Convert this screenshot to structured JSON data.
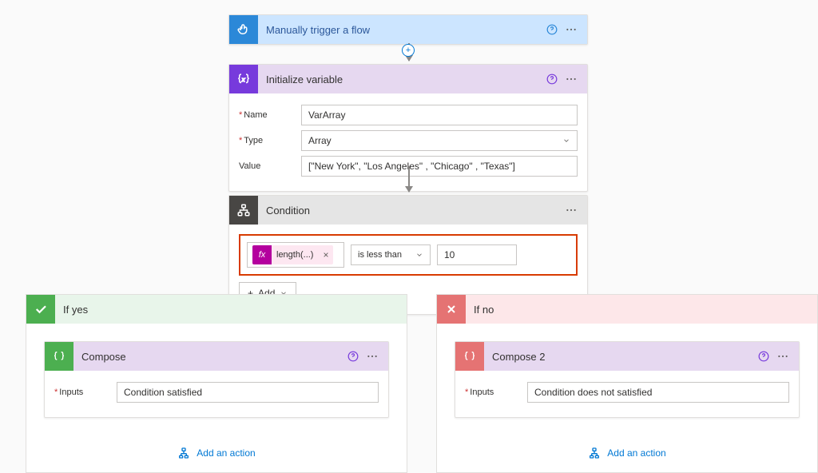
{
  "trigger": {
    "title": "Manually trigger a flow"
  },
  "initvar": {
    "title": "Initialize variable",
    "name_label": "Name",
    "type_label": "Type",
    "value_label": "Value",
    "name_value": "VarArray",
    "type_value": "Array",
    "value_value": "[\"New York\", \"Los Angeles\" , \"Chicago\" , \"Texas\"]"
  },
  "condition": {
    "title": "Condition",
    "token_label": "length(...)",
    "operator": "is less than",
    "value": "10",
    "add_label": "Add"
  },
  "branches": {
    "yes": {
      "title": "If yes",
      "compose_title": "Compose",
      "inputs_label": "Inputs",
      "inputs_value": "Condition satisfied",
      "add_action": "Add an action"
    },
    "no": {
      "title": "If no",
      "compose_title": "Compose 2",
      "inputs_label": "Inputs",
      "inputs_value": "Condition does not satisfied",
      "add_action": "Add an action"
    }
  }
}
